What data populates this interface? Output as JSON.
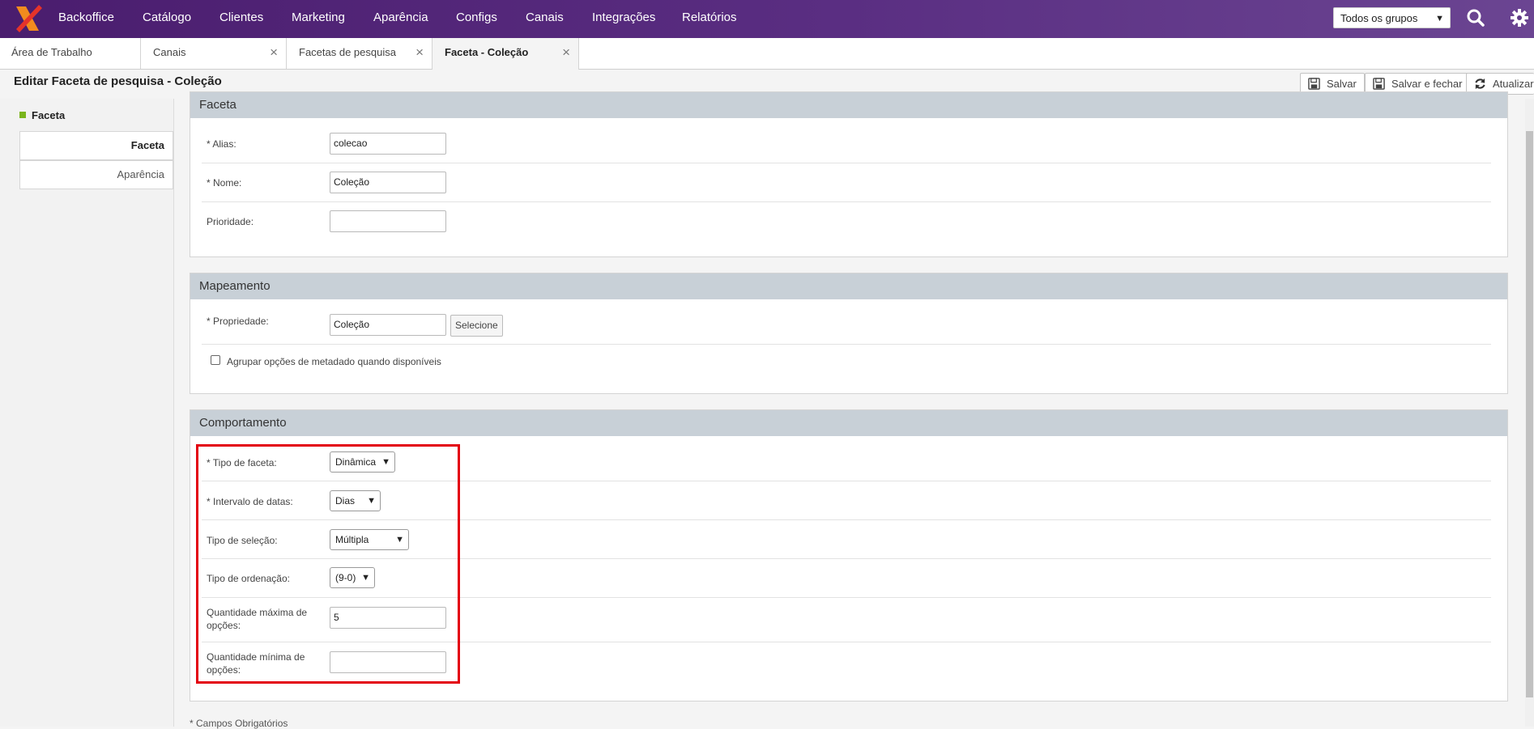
{
  "nav": {
    "items": [
      "Backoffice",
      "Catálogo",
      "Clientes",
      "Marketing",
      "Aparência",
      "Configs",
      "Canais",
      "Integrações",
      "Relatórios"
    ],
    "group_select": "Todos os grupos",
    "icons": [
      "search-icon",
      "gear-icon"
    ]
  },
  "tabs": [
    "Área de Trabalho",
    "Canais",
    "Facetas de pesquisa",
    "Faceta - Coleção"
  ],
  "active_tab": "Faceta - Coleção",
  "header": {
    "title": "Editar Faceta de pesquisa - Coleção",
    "save_label": "Salvar",
    "save_close_label": "Salvar e fechar",
    "refresh_label": "Atualizar"
  },
  "left": {
    "heading": "Faceta",
    "items": [
      "Faceta",
      "Aparência"
    ]
  },
  "faceta": {
    "title": "Faceta",
    "alias_label": "* Alias:",
    "alias_value": "colecao",
    "nome_label": "* Nome:",
    "nome_value": "Coleção",
    "prioridade_label": "Prioridade:",
    "prioridade_value": ""
  },
  "mapeamento": {
    "title": "Mapeamento",
    "propriedade_label": "* Propriedade:",
    "propriedade_value": "Coleção",
    "selecione_label": "Selecione",
    "agrupar_label": "Agrupar opções de metadado quando disponíveis",
    "agrupar_checked": false
  },
  "comportamento": {
    "title": "Comportamento",
    "tipo_faceta_label": "* Tipo de faceta:",
    "tipo_faceta_value": "Dinâmica",
    "intervalo_label": "* Intervalo de datas:",
    "intervalo_value": "Dias",
    "tipo_selecao_label": "Tipo de seleção:",
    "tipo_selecao_value": "Múltipla",
    "tipo_ordenacao_label": "Tipo de ordenação:",
    "tipo_ordenacao_value": "(9-0)",
    "qtd_max_label": "Quantidade máxima de opções:",
    "qtd_max_value": "5",
    "qtd_min_label": "Quantidade mínima de opções:",
    "qtd_min_value": ""
  },
  "footer": {
    "note": "* Campos Obrigatórios"
  },
  "colors": {
    "nav_bg": "#5a2e82",
    "section_header": "#c8d0d7",
    "highlight": "#e3000f",
    "accent_green": "#7ab51d"
  }
}
